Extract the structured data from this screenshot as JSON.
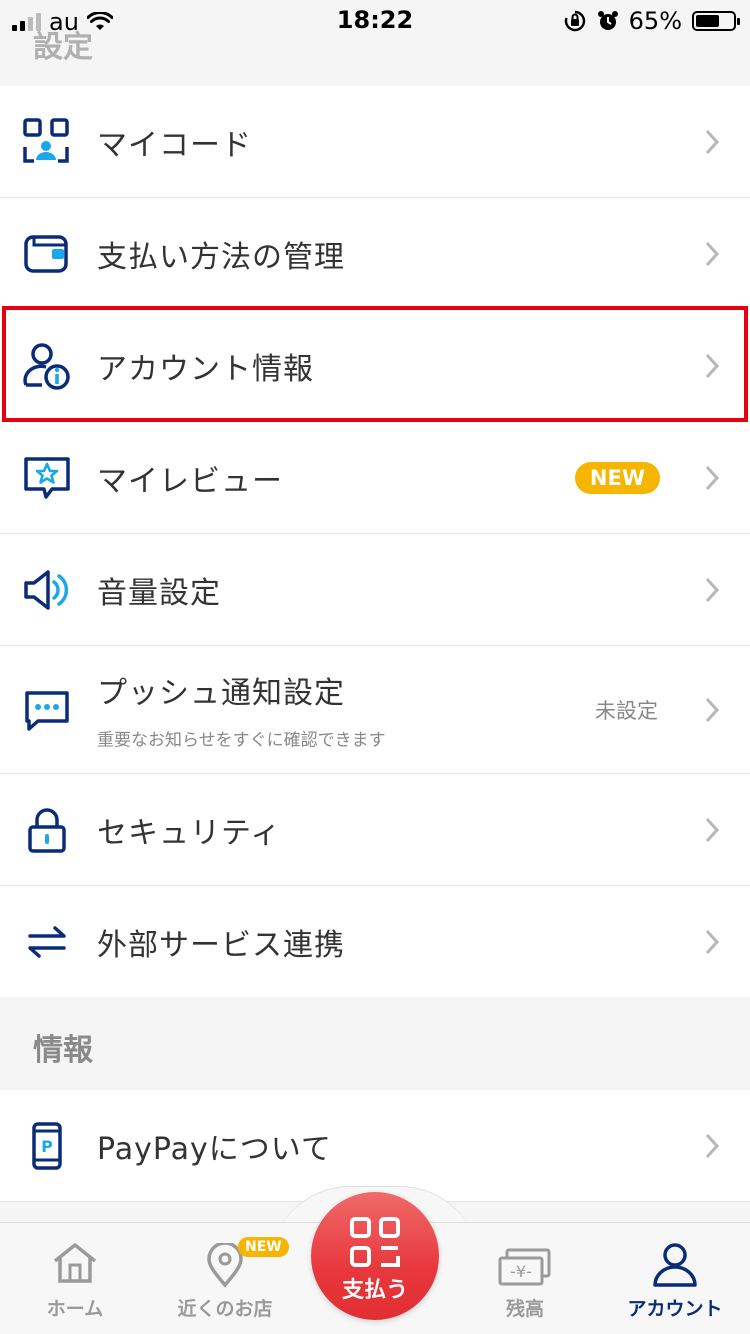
{
  "status_bar": {
    "carrier": "au",
    "time": "18:22",
    "battery": "65%",
    "battery_level": 0.65
  },
  "settings_section": {
    "title": "設定"
  },
  "settings_items": [
    {
      "label": "マイコード",
      "icon": "qr-code-icon"
    },
    {
      "label": "支払い方法の管理",
      "icon": "wallet-icon"
    },
    {
      "label": "アカウント情報",
      "icon": "account-info-icon"
    },
    {
      "label": "マイレビュー",
      "icon": "review-star-icon",
      "badge": "NEW"
    },
    {
      "label": "音量設定",
      "icon": "speaker-icon"
    },
    {
      "label": "プッシュ通知設定",
      "icon": "chat-bubble-icon",
      "sub": "重要なお知らせをすぐに確認できます",
      "value": "未設定"
    },
    {
      "label": "セキュリティ",
      "icon": "lock-icon"
    },
    {
      "label": "外部サービス連携",
      "icon": "swap-arrows-icon"
    }
  ],
  "info_section": {
    "title": "情報"
  },
  "info_items": [
    {
      "label": "PayPayについて",
      "icon": "phone-paypay-icon"
    }
  ],
  "tabbar": {
    "home": "ホーム",
    "nearby": "近くのお店",
    "nearby_badge": "NEW",
    "pay": "支払う",
    "balance": "残高",
    "account": "アカウント",
    "active": "account"
  },
  "colors": {
    "icon_navy": "#0a2c78",
    "icon_cyan": "#1aa7ec",
    "highlight": "#e60012",
    "badge": "#f7b500",
    "pay_red": "#e8383d"
  }
}
